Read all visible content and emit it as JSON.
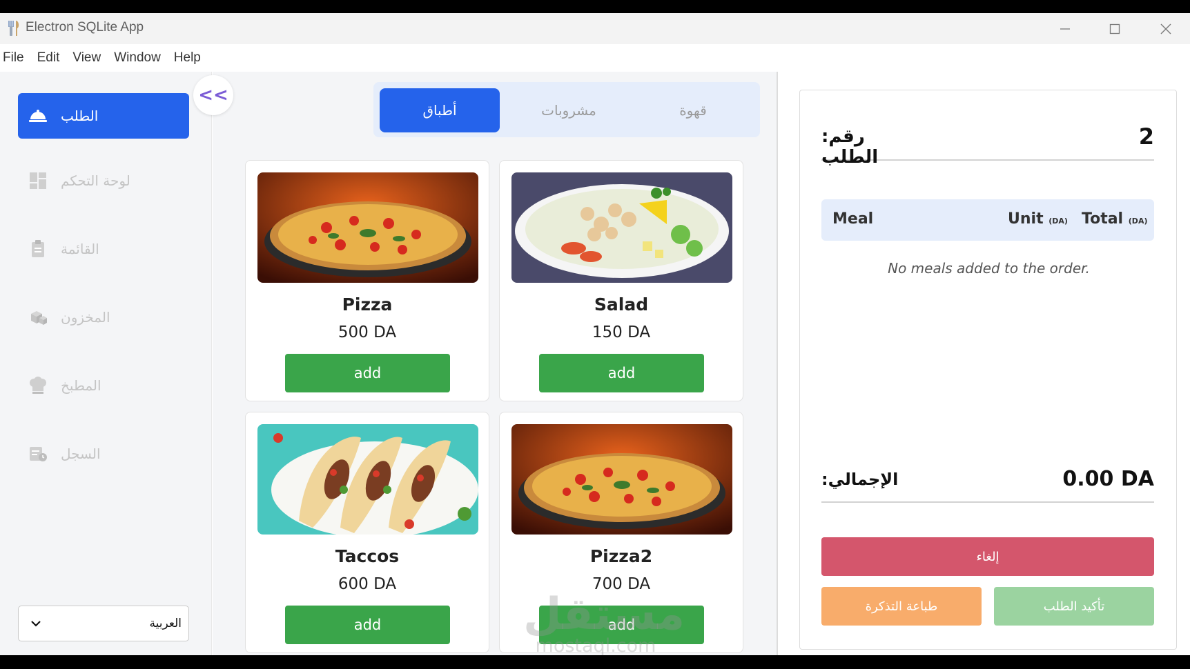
{
  "window": {
    "title": "Electron SQLite App",
    "controls": {
      "minimize": "minimize-icon",
      "maximize": "maximize-icon",
      "close": "close-icon"
    }
  },
  "menu": [
    "File",
    "Edit",
    "View",
    "Window",
    "Help"
  ],
  "sidebar": {
    "collapse_label": "<<",
    "items": [
      {
        "label": "الطلب",
        "icon": "dish-cover-icon",
        "active": true
      },
      {
        "label": "لوحة التحكم",
        "icon": "dashboard-grid-icon",
        "active": false
      },
      {
        "label": "القائمة",
        "icon": "clipboard-icon",
        "active": false
      },
      {
        "label": "المخزون",
        "icon": "boxes-icon",
        "active": false
      },
      {
        "label": "المطبخ",
        "icon": "chef-hat-icon",
        "active": false
      },
      {
        "label": "السجل",
        "icon": "history-icon",
        "active": false
      }
    ],
    "language": "العربية"
  },
  "tabs": [
    {
      "label": "أطباق",
      "active": true
    },
    {
      "label": "مشروبات",
      "active": false
    },
    {
      "label": "قهوة",
      "active": false
    }
  ],
  "meals": [
    {
      "name": "Pizza",
      "price": "500 DA",
      "add_label": "add",
      "image": "pizza"
    },
    {
      "name": "Salad",
      "price": "150 DA",
      "add_label": "add",
      "image": "salad"
    },
    {
      "name": "Taccos",
      "price": "600 DA",
      "add_label": "add",
      "image": "tacos"
    },
    {
      "name": "Pizza2",
      "price": "700 DA",
      "add_label": "add",
      "image": "pizza"
    }
  ],
  "order": {
    "number_label": ":رقم الطلب",
    "number": "2",
    "columns": {
      "meal": "Meal",
      "unit": "Unit",
      "total": "Total",
      "currency": "(DA)"
    },
    "empty_message": "No meals added to the order.",
    "total_label": ":الإجمالي",
    "total_value": "0.00 DA",
    "cancel_label": "إلغاء",
    "print_label": "طباعة التذكرة",
    "confirm_label": "تأكيد الطلب"
  },
  "watermark": {
    "arabic": "مستقل",
    "latin": "mostaql.com"
  },
  "colors": {
    "primary": "#2563eb",
    "add": "#3aa54a",
    "cancel": "#d4566c",
    "print": "#f8ac6b",
    "confirm": "#9bd3a0"
  }
}
